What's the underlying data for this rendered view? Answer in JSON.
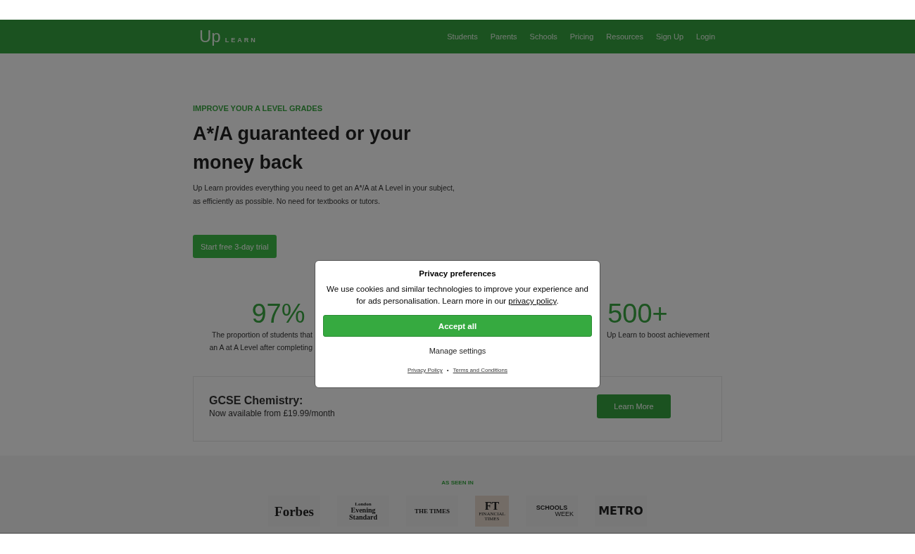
{
  "header": {
    "logo": {
      "mark": "Up",
      "word": "LEARN"
    },
    "nav": [
      {
        "label": "Students"
      },
      {
        "label": "Parents"
      },
      {
        "label": "Schools"
      },
      {
        "label": "Pricing"
      },
      {
        "label": "Resources"
      },
      {
        "label": "Sign Up"
      },
      {
        "label": "Login"
      }
    ]
  },
  "hero": {
    "eyebrow": "IMPROVE YOUR A LEVEL GRADES",
    "title": "A*/A guaranteed or your money back",
    "text": "Up Learn provides everything you need to get an A*/A at A Level in your subject, as efficiently as possible. No need for textbooks or tutors.",
    "button": "Start free 3-day trial"
  },
  "stats": [
    {
      "value": "97%",
      "lines": [
        "The proportion of students that",
        "an A at A Level after completing"
      ]
    },
    {
      "value": "500+",
      "lines": [
        "Up Learn to boost achievement"
      ]
    }
  ],
  "promo": {
    "title": "GCSE Chemistry:",
    "text": "Now available from £19.99/month",
    "button": "Learn More"
  },
  "press": {
    "heading": "AS SEEN IN",
    "logos": [
      {
        "kind": "forbes",
        "lines": [
          "Forbes"
        ]
      },
      {
        "kind": "standard",
        "lines": [
          "London",
          "Evening",
          "Standard"
        ]
      },
      {
        "kind": "times",
        "lines": [
          "THE TIMES"
        ]
      },
      {
        "kind": "ft",
        "lines": [
          "FT",
          "FINANCIAL",
          "TIMES"
        ]
      },
      {
        "kind": "schools",
        "lines": [
          "SCHOOLS",
          "WEEK"
        ]
      },
      {
        "kind": "metro",
        "lines": [
          "METRO"
        ]
      }
    ]
  },
  "dialog": {
    "title": "Privacy preferences",
    "text": "We use cookies and similar technologies to improve your experience and for ads personalisation. Learn more in our ",
    "link": "privacy policy",
    "after": ".",
    "accept": "Accept all",
    "manage": "Manage settings",
    "footer_links": [
      "Privacy Policy",
      "Terms and Conditions"
    ],
    "separator": "•"
  }
}
